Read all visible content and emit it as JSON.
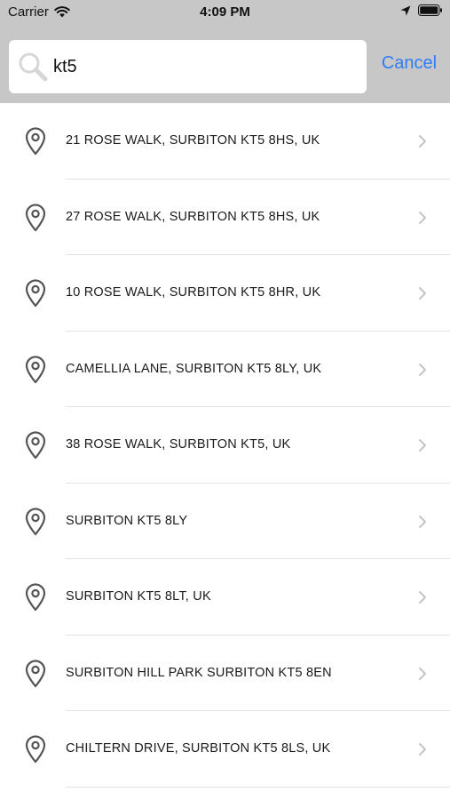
{
  "status_bar": {
    "carrier": "Carrier",
    "time": "4:09 PM",
    "icons": [
      "wifi-icon",
      "location-arrow-icon",
      "battery-icon"
    ]
  },
  "search": {
    "value": "kt5",
    "icon": "search-icon",
    "cancel_label": "Cancel"
  },
  "results": [
    {
      "label": "21 ROSE WALK, SURBITON KT5 8HS, UK"
    },
    {
      "label": "27 ROSE WALK, SURBITON KT5 8HS, UK"
    },
    {
      "label": "10 ROSE WALK, SURBITON KT5 8HR, UK"
    },
    {
      "label": "CAMELLIA LANE, SURBITON KT5 8LY, UK"
    },
    {
      "label": "38 ROSE WALK, SURBITON KT5, UK"
    },
    {
      "label": "SURBITON KT5 8LY"
    },
    {
      "label": "SURBITON KT5 8LT, UK"
    },
    {
      "label": "SURBITON HILL PARK SURBITON KT5 8EN"
    },
    {
      "label": "CHILTERN DRIVE, SURBITON KT5 8LS, UK"
    }
  ],
  "colors": {
    "header_background": "#c7c7c7",
    "accent": "#2f7cf6",
    "separator": "#e3e3e3",
    "chevron": "#c4c4c8",
    "pin": "#555555"
  }
}
